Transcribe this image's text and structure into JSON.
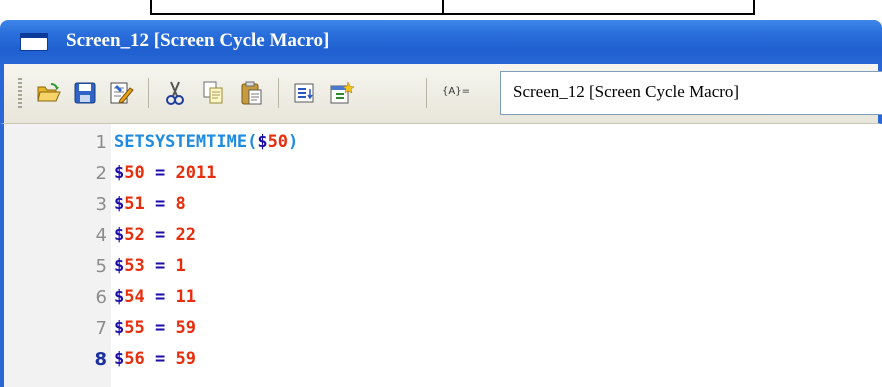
{
  "window": {
    "title": "Screen_12 [Screen Cycle Macro]"
  },
  "toolbar": {
    "buttons": [
      {
        "icon": "open-folder-icon",
        "tooltip": ""
      },
      {
        "icon": "save-icon",
        "tooltip": ""
      },
      {
        "icon": "edit-document-icon",
        "tooltip": ""
      },
      {
        "icon": "cut-icon",
        "tooltip": ""
      },
      {
        "icon": "copy-icon",
        "tooltip": ""
      },
      {
        "icon": "paste-icon",
        "tooltip": ""
      },
      {
        "icon": "insert-list-icon",
        "tooltip": ""
      },
      {
        "icon": "insert-window-icon",
        "tooltip": ""
      }
    ],
    "macro_label": "{A}=",
    "macro_name_value": "Screen_12 [Screen Cycle Macro]"
  },
  "editor": {
    "lines": [
      {
        "number": "1",
        "tokens": [
          [
            "kw",
            "SETSYSTEMTIME"
          ],
          [
            "kw",
            "("
          ],
          [
            "var",
            "$"
          ],
          [
            "num",
            "50"
          ],
          [
            "kw",
            ")"
          ]
        ]
      },
      {
        "number": "2",
        "tokens": [
          [
            "var",
            "$"
          ],
          [
            "num",
            "50"
          ],
          [
            "var",
            " = "
          ],
          [
            "num",
            "2011"
          ]
        ]
      },
      {
        "number": "3",
        "tokens": [
          [
            "var",
            "$"
          ],
          [
            "num",
            "51"
          ],
          [
            "var",
            " = "
          ],
          [
            "num",
            "8"
          ]
        ]
      },
      {
        "number": "4",
        "tokens": [
          [
            "var",
            "$"
          ],
          [
            "num",
            "52"
          ],
          [
            "var",
            " = "
          ],
          [
            "num",
            "22"
          ]
        ]
      },
      {
        "number": "5",
        "tokens": [
          [
            "var",
            "$"
          ],
          [
            "num",
            "53"
          ],
          [
            "var",
            " = "
          ],
          [
            "num",
            "1"
          ]
        ]
      },
      {
        "number": "6",
        "tokens": [
          [
            "var",
            "$"
          ],
          [
            "num",
            "54"
          ],
          [
            "var",
            " = "
          ],
          [
            "num",
            "11"
          ]
        ]
      },
      {
        "number": "7",
        "tokens": [
          [
            "var",
            "$"
          ],
          [
            "num",
            "55"
          ],
          [
            "var",
            " = "
          ],
          [
            "num",
            "59"
          ]
        ]
      },
      {
        "number": "8",
        "tokens": [
          [
            "var",
            "$"
          ],
          [
            "num",
            "56"
          ],
          [
            "var",
            " = "
          ],
          [
            "num",
            "59"
          ]
        ]
      }
    ],
    "current_line": "8"
  },
  "colors": {
    "titlebar": "#2a6fdc",
    "keyword": "#1f8be0",
    "variable": "#1a0aa8",
    "number": "#e82d0c",
    "line_number": "#8c8c8c"
  }
}
